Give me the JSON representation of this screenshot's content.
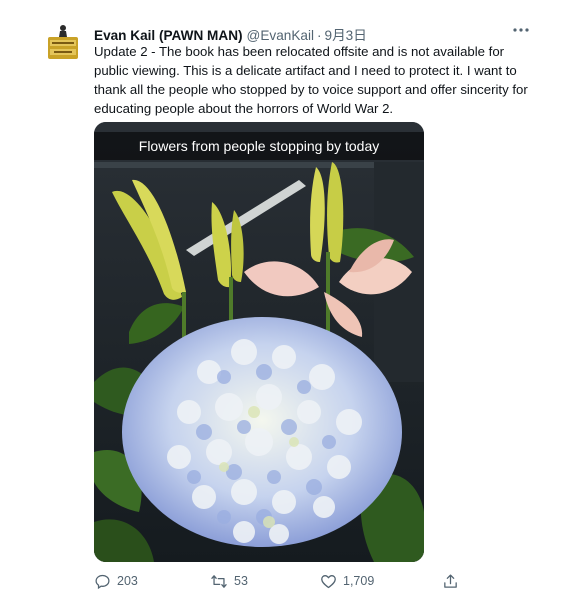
{
  "user": {
    "display_name": "Evan Kail (PAWN MAN)",
    "handle": "@EvanKail",
    "separator": "·",
    "date": "9月3日",
    "avatar_text": "PAWN MAN"
  },
  "tweet": {
    "lines": [
      "Update 2 - The book has been relocated offsite and is not available for",
      "public viewing. This is a delicate artifact and I need to protect it. I want to",
      "thank all the people who stopped by to voice support and offer sincerity for",
      "educating people about the horrors of World War 2."
    ],
    "media_caption": "Flowers from people stopping by today"
  },
  "actions": {
    "reply_count": "203",
    "retweet_count": "53",
    "like_count": "1,709"
  },
  "icons": {
    "more": "more-horizontal-icon",
    "reply": "reply-icon",
    "retweet": "retweet-icon",
    "like": "heart-icon",
    "share": "share-icon"
  },
  "colors": {
    "text": "#0f1419",
    "secondary": "#536471",
    "background": "#ffffff"
  }
}
